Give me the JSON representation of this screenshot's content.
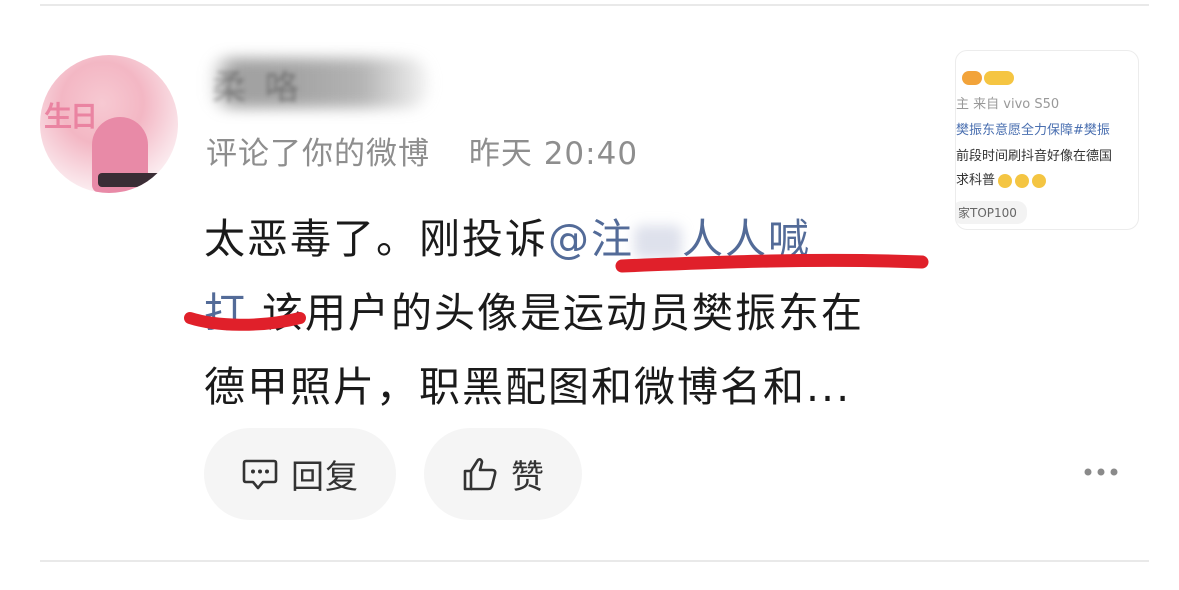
{
  "comment": {
    "username_visible_fragment": "柔 咯",
    "action_text": "评论了你的微博",
    "time": "昨天 20:40",
    "content": {
      "line1_prefix": "太恶毒了。刚投诉",
      "mention_start": "@注",
      "mention_end": "人人喊",
      "line2_mention_tail": "打",
      "line2_rest": " 该用户的头像是运动员樊振东在",
      "line3": "德甲照片，职黑配图和微博名和..."
    },
    "actions": {
      "reply_label": "回复",
      "like_label": "赞"
    },
    "avatar_text": "生日"
  },
  "original_post_card": {
    "source": "主  来自 vivo S50",
    "topic_line": "樊振东意愿全力保障#樊振",
    "text_line2": "前段时间刷抖音好像在德国",
    "text_line3": "求科普",
    "tag": "家TOP100"
  },
  "colors": {
    "mention": "#536b98",
    "meta_gray": "#8e8e8e",
    "button_bg": "#f5f5f5",
    "annotation_red": "#e0202a"
  }
}
